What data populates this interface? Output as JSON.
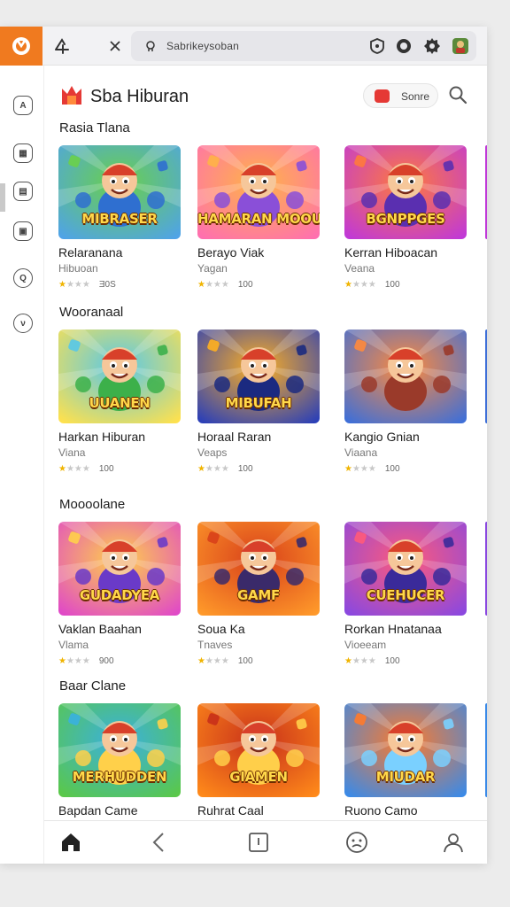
{
  "browser": {
    "url": "Sabrikeysoban",
    "brand_color": "#f07a1f",
    "icons": [
      "logo-icon",
      "add-tab-icon",
      "close-icon",
      "lock-icon",
      "shield-icon",
      "settings-icon",
      "gear-icon",
      "profile-icon"
    ]
  },
  "sidebar": {
    "items": [
      {
        "icon": "home-icon",
        "glyph": "A"
      },
      {
        "icon": "apps-icon",
        "glyph": "▦"
      },
      {
        "icon": "store-icon",
        "glyph": "▤"
      },
      {
        "icon": "library-icon",
        "glyph": "▣"
      },
      {
        "icon": "search-icon",
        "glyph": "Q"
      },
      {
        "icon": "info-icon",
        "glyph": "ν"
      }
    ]
  },
  "header": {
    "title": "Sba Hiburan",
    "search_label": "Sonre",
    "accent": "#e53935"
  },
  "sections": [
    {
      "title": "Rasia Tlana",
      "cards": [
        {
          "thumb_text": "MIBRASER",
          "name": "Relaranana",
          "sub": "Hibuoan",
          "stars": 1,
          "rating": "Ǝ0S",
          "palette": [
            "#4fa3e8",
            "#6ad04a",
            "#2f6fd0"
          ]
        },
        {
          "thumb_text": "HAMARAN MOOUGER",
          "name": "Berayo Viak",
          "sub": "Yagan",
          "stars": 1,
          "rating": "100",
          "palette": [
            "#ff6fb0",
            "#ffb347",
            "#8a4fd8"
          ]
        },
        {
          "thumb_text": "BGNPPGES",
          "name": "Kerran Hiboacan",
          "sub": "Veana",
          "stars": 1,
          "rating": "100",
          "palette": [
            "#c038d8",
            "#ff7a3c",
            "#5a2fb0"
          ]
        }
      ]
    },
    {
      "title": "Wooranaal",
      "cards": [
        {
          "thumb_text": "UUANEN",
          "name": "Harkan Hiburan",
          "sub": "Viana",
          "stars": 1,
          "rating": "100",
          "palette": [
            "#ffe14d",
            "#58c8e8",
            "#3cb04a"
          ]
        },
        {
          "thumb_text": "MIBUFAH",
          "name": "Horaal Raran",
          "sub": "Veaps",
          "stars": 1,
          "rating": "100",
          "palette": [
            "#2a3fb8",
            "#ffb020",
            "#1b2a80"
          ]
        },
        {
          "thumb_text": "",
          "name": "Kangio Gnian",
          "sub": "Viaana",
          "stars": 1,
          "rating": "100",
          "palette": [
            "#3e6fd8",
            "#ff8a3c",
            "#9a3a2a"
          ]
        }
      ]
    },
    {
      "title": "Moooolane",
      "cards": [
        {
          "thumb_text": "GUDADYEA",
          "name": "Vaklan Baahan",
          "sub": "Vlama",
          "stars": 1,
          "rating": "900",
          "palette": [
            "#e048c8",
            "#ffd04a",
            "#6a3ac8"
          ]
        },
        {
          "thumb_text": "GAMF",
          "name": "Soua Ka",
          "sub": "Tnaves",
          "stars": 1,
          "rating": "100",
          "palette": [
            "#ff9a2a",
            "#d8401a",
            "#3a2a6a"
          ]
        },
        {
          "thumb_text": "CUEHUCER",
          "name": "Rorkan Hnatanaa",
          "sub": "Vioeeam",
          "stars": 1,
          "rating": "100",
          "palette": [
            "#8a48e0",
            "#ff5a7a",
            "#3a2a9a"
          ]
        }
      ]
    },
    {
      "title": "Baar Clane",
      "cards": [
        {
          "thumb_text": "MERHUDDEN",
          "name": "Bapdan Came",
          "sub": "",
          "stars": 0,
          "rating": "",
          "palette": [
            "#5ac848",
            "#3ab0e0",
            "#ffd04a"
          ]
        },
        {
          "thumb_text": "GIAMEN",
          "name": "Ruhrat Caal",
          "sub": "",
          "stars": 0,
          "rating": "",
          "palette": [
            "#ff8a1a",
            "#c8301a",
            "#ffcf4a"
          ]
        },
        {
          "thumb_text": "MIUDAR",
          "name": "Ruono Camo",
          "sub": "",
          "stars": 0,
          "rating": "",
          "palette": [
            "#3a8ae8",
            "#ff7a2a",
            "#7ad0ff"
          ]
        }
      ]
    }
  ],
  "bottom_nav": [
    "home-icon",
    "back-icon",
    "tabs-icon",
    "emoji-icon",
    "profile-icon"
  ]
}
